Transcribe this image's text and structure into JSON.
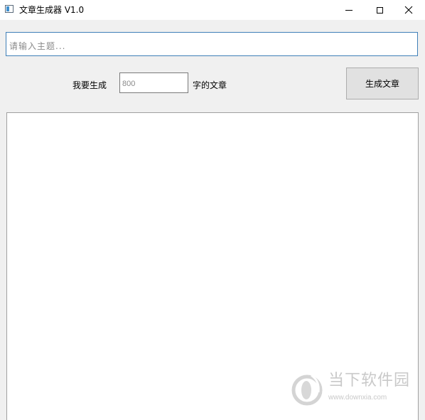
{
  "window": {
    "title": "文章生成器 V1.0",
    "icon": "app-window-icon",
    "controls": [
      "minimize-icon",
      "maximize-icon",
      "close-icon"
    ]
  },
  "topic_input": {
    "value": "",
    "placeholder": "请输入主题..."
  },
  "length_row": {
    "prefix_label": "我要生成",
    "count_value": "",
    "count_placeholder": "800",
    "suffix_label": "字的文章"
  },
  "generate_button": {
    "label": "生成文章"
  },
  "output": {
    "value": ""
  },
  "watermark": {
    "name": "当下软件园",
    "url": "www.downxia.com",
    "color": "#c9c9c9"
  },
  "colors": {
    "window_bg": "#f0f0f0",
    "titlebar_bg": "#ffffff",
    "focus_border": "#3f7fb8",
    "button_bg": "#e1e1e1"
  }
}
